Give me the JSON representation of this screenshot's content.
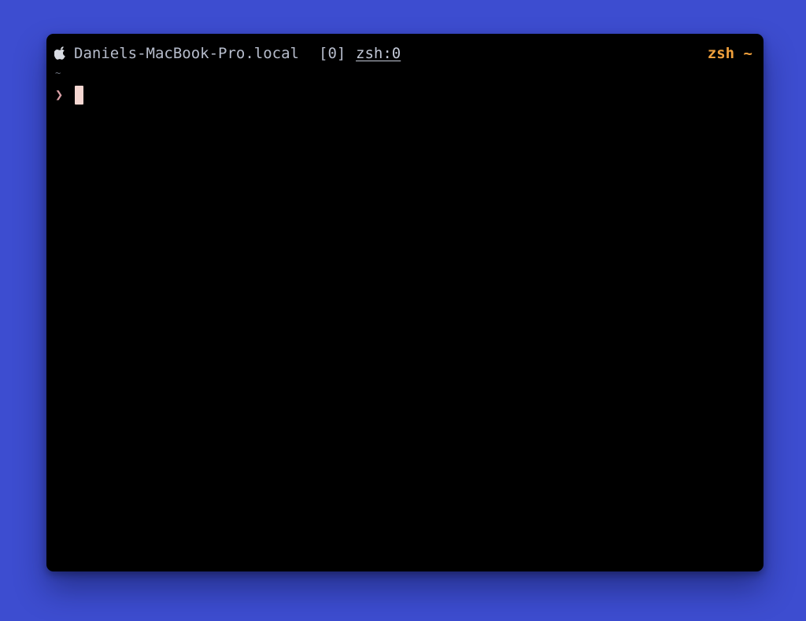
{
  "status_bar": {
    "apple_icon": "apple-logo-icon",
    "hostname": "Daniels-MacBook-Pro.local",
    "window_index": "[0]",
    "window_name": "zsh:0",
    "right_status": "zsh ~"
  },
  "shell": {
    "cwd": "~",
    "prompt": "❯"
  },
  "colors": {
    "background": "#3d4dd0",
    "terminal": "#000000",
    "accent": "#f0a03c",
    "prompt": "#d9a0a6",
    "cursor": "#f5d7d2"
  }
}
